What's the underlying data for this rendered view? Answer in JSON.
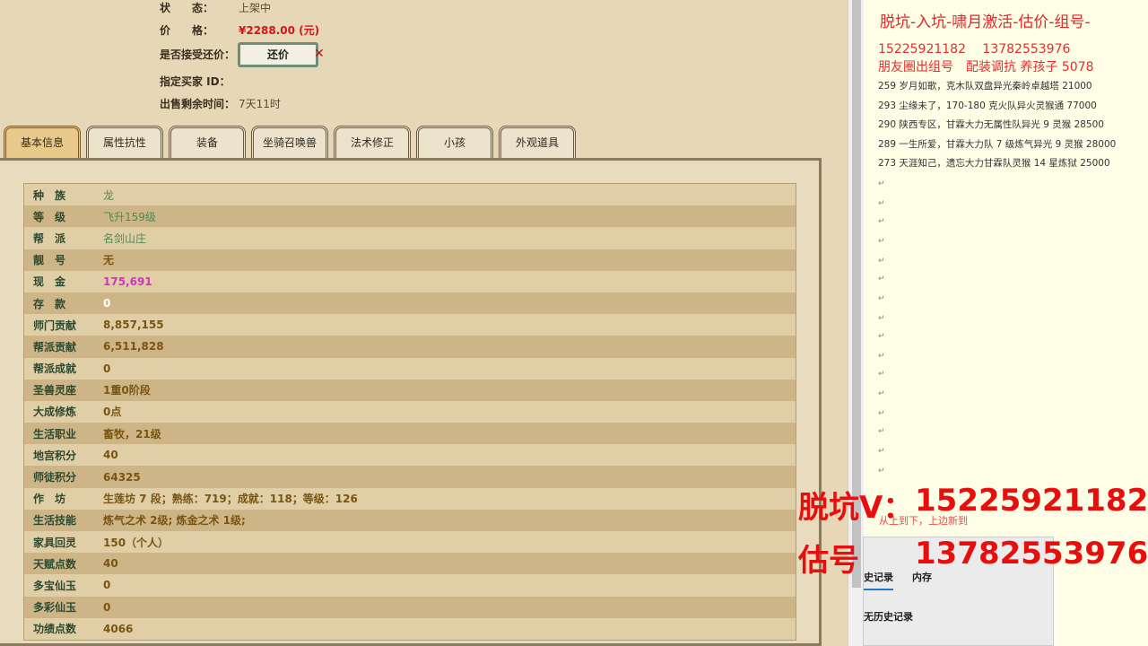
{
  "info": [
    {
      "label": "状　　态：",
      "value": "上架中"
    },
    {
      "label": "价　　格：",
      "value": "¥2288.00 (元)"
    },
    {
      "label": "是否接受还价：",
      "value": ""
    },
    {
      "label": "指定买家 ID：",
      "value": ""
    },
    {
      "label": "出售剩余时间：",
      "value": "7天11时"
    }
  ],
  "bargain_label": "还价",
  "tabs": [
    "基本信息",
    "属性抗性",
    "装备",
    "坐骑召唤兽",
    "法术修正",
    "小孩",
    "外观道具"
  ],
  "rows": [
    {
      "k": "种　族",
      "v": "龙",
      "c": "green"
    },
    {
      "k": "等　级",
      "v": "飞升159级",
      "c": "green"
    },
    {
      "k": "帮　派",
      "v": "名剑山庄",
      "c": "green"
    },
    {
      "k": "靓　号",
      "v": "无",
      "c": ""
    },
    {
      "k": "现　金",
      "v": "175,691",
      "c": "mag"
    },
    {
      "k": "存　款",
      "v": "0",
      "c": "white"
    },
    {
      "k": "师门贡献",
      "v": "8,857,155",
      "c": ""
    },
    {
      "k": "帮派贡献",
      "v": "6,511,828",
      "c": ""
    },
    {
      "k": "帮派成就",
      "v": "0",
      "c": ""
    },
    {
      "k": "圣兽灵座",
      "v": "1重0阶段",
      "c": ""
    },
    {
      "k": "大成修炼",
      "v": "0点",
      "c": ""
    },
    {
      "k": "生活职业",
      "v": "畜牧，21级",
      "c": ""
    },
    {
      "k": "地宫积分",
      "v": "40",
      "c": ""
    },
    {
      "k": "师徒积分",
      "v": "64325",
      "c": ""
    },
    {
      "k": "作　坊",
      "v": "生莲坊 7 段；熟练：719；成就：118；等级：126",
      "c": ""
    },
    {
      "k": "生活技能",
      "v": "炼气之术 2级; 炼金之术 1级;",
      "c": ""
    },
    {
      "k": "家具回灵",
      "v": "150（个人）",
      "c": ""
    },
    {
      "k": "天赋点数",
      "v": "40",
      "c": ""
    },
    {
      "k": "多宝仙玉",
      "v": "0",
      "c": ""
    },
    {
      "k": "多彩仙玉",
      "v": "0",
      "c": ""
    },
    {
      "k": "功绩点数",
      "v": "4066",
      "c": ""
    }
  ],
  "doc": {
    "title": "脱坑-入坑-啸月激活-估价-组号-",
    "phones": "15225921182　 13782553976",
    "ad": "朋友圈出组号　配装调抗 养孩子 5078",
    "lines": [
      "259 岁月如歌，克木队双盘异光秦岭卓越塔 21000",
      "293 尘缘未了，170-180 克火队异火灵猴通 77000",
      "290 陕西专区，甘霖大力无属性队异光 9 灵猴 28500",
      "289 一生所爱，甘霖大力队 7 级炼气异光 9 灵猴 28000",
      "273 天涯知己，遗忘大力甘霖队灵猴 14 星炼狱 25000"
    ],
    "note": "从上到下，上边新到"
  },
  "calc": {
    "tab_history": "史记录",
    "tab_memory": "内存",
    "empty": "无历史记录"
  },
  "watermark": {
    "line1_label": "脱坑V：",
    "line1_num": "15225921182",
    "line2_label": "估号",
    "line2_num": "13782553976"
  }
}
